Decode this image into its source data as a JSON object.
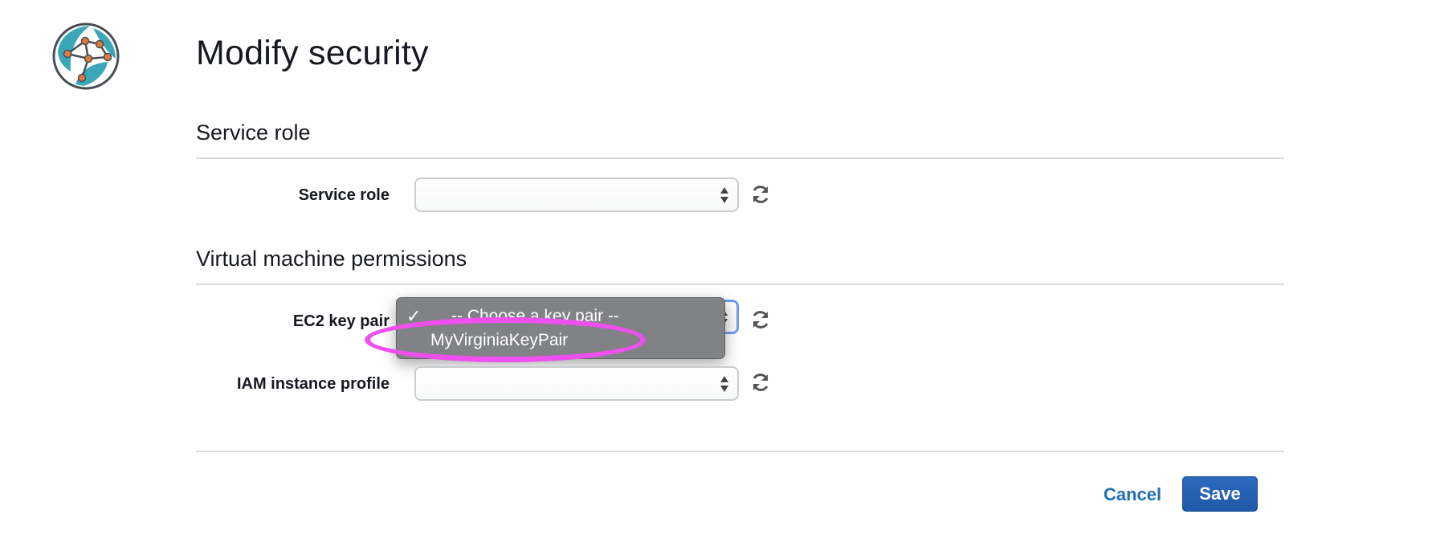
{
  "page": {
    "title": "Modify security"
  },
  "sections": {
    "service_role": {
      "heading": "Service role",
      "field_label": "Service role",
      "selected_value": ""
    },
    "vm_permissions": {
      "heading": "Virtual machine permissions",
      "ec2_key_pair": {
        "label": "EC2 key pair",
        "options": [
          "-- Choose a key pair --",
          "MyVirginiaKeyPair"
        ]
      },
      "iam_instance_profile": {
        "label": "IAM instance profile",
        "selected_value": ""
      }
    }
  },
  "footer": {
    "cancel_label": "Cancel",
    "save_label": "Save"
  },
  "colors": {
    "accent_link": "#1f6fb5",
    "primary_button": "#2c69bd",
    "highlight": "#ee4fee",
    "dropdown_bg": "#808285"
  },
  "icons": {
    "logo": "globe-network-icon",
    "refresh": "refresh-icon",
    "select_arrows": "up-down-arrows-icon",
    "selected_check": "checkmark-icon"
  }
}
